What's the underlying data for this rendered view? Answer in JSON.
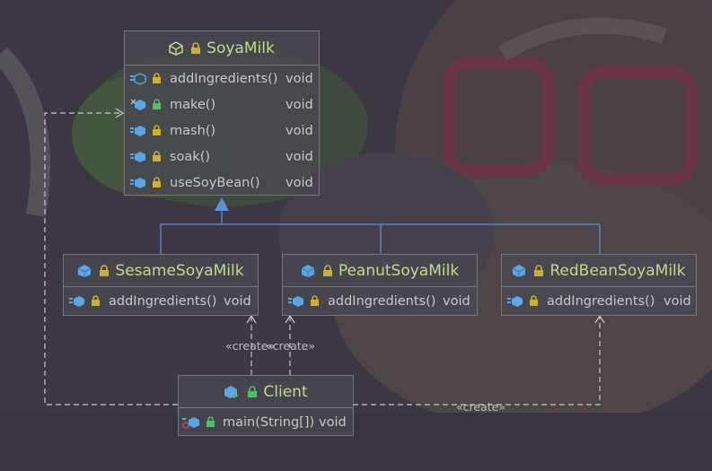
{
  "colors": {
    "class_name": "#c2d98a",
    "text": "#c8c8c8",
    "line": "#5b8fd6",
    "dashed": "#c8c8c8"
  },
  "classes": {
    "soyamilk": {
      "name": "SoyaMilk",
      "icon": "abstract-class-icon",
      "methods": [
        {
          "name": "addIngredients()",
          "type": "void",
          "icon": "abstract-method-icon"
        },
        {
          "name": "make()",
          "type": "void",
          "icon": "final-method-icon"
        },
        {
          "name": "mash()",
          "type": "void",
          "icon": "method-icon"
        },
        {
          "name": "soak()",
          "type": "void",
          "icon": "method-icon"
        },
        {
          "name": "useSoyBean()",
          "type": "void",
          "icon": "method-icon"
        }
      ]
    },
    "sesame": {
      "name": "SesameSoyaMilk",
      "icon": "class-icon",
      "methods": [
        {
          "name": "addIngredients()",
          "type": "void",
          "icon": "override-method-icon"
        }
      ]
    },
    "peanut": {
      "name": "PeanutSoyaMilk",
      "icon": "class-icon",
      "methods": [
        {
          "name": "addIngredients()",
          "type": "void",
          "icon": "override-method-icon"
        }
      ]
    },
    "redbean": {
      "name": "RedBeanSoyaMilk",
      "icon": "class-icon",
      "methods": [
        {
          "name": "addIngredients()",
          "type": "void",
          "icon": "override-method-icon"
        }
      ]
    },
    "client": {
      "name": "Client",
      "icon": "class-icon",
      "methods": [
        {
          "name": "main(String[])",
          "type": "void",
          "icon": "static-method-icon"
        }
      ]
    }
  },
  "relations": {
    "create1": "«create»",
    "create2": "«create»",
    "create3": "«create»"
  }
}
